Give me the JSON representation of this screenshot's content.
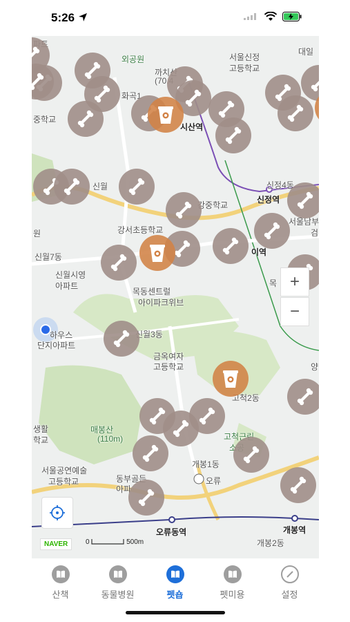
{
  "status_bar": {
    "time": "5:26"
  },
  "map": {
    "labels": {
      "park": "외공원",
      "kkachisan": "까치산",
      "kkachisan_sub": "(70.4",
      "hwagok": "화곡1",
      "sinwon_station": "시산역",
      "seoul_singung": "서울신정",
      "seoul_singung2": "고등학교",
      "daeil": "대일",
      "sinjeong4": "신정4동",
      "sinjeong_station": "신정역",
      "gangjung": "강중학교",
      "gangseo": "강서초등학교",
      "seoulyanggok": "서울남부",
      "geom": "검",
      "sinwol7": "신월7동",
      "sinwol": "신월",
      "sinwolsi": "신월시영",
      "apart": "아파트",
      "mokdong_central": "목동센트럴",
      "ipark": "아이파크위브",
      "sinwol3": "신월3동",
      "house": "하우스",
      "danji": "단지아파트",
      "geumok": "금옥여자",
      "geumok2": "고등학교",
      "gocheok2": "고척2동",
      "maebongsan": "매봉산",
      "maebongsan_h": "(110m)",
      "gocheok_geun": "고척근린",
      "gocheok_geun2": "소공",
      "gaebong1": "개봉1동",
      "seoul_art": "서울공연예술",
      "seoul_art2": "고등학교",
      "dongbu": "동부골든",
      "dongbu2": "아파",
      "oryu_ic": "오류",
      "oryudong_station": "오류동역",
      "gaebong_station": "개봉역",
      "gaebong2": "개봉2동",
      "jungk": "중학교",
      "ipa": "아파",
      "sw": "생활",
      "sw2": "학교",
      "won": "원",
      "ok": "목",
      "yang": "양",
      "sinwon_stop": "신월",
      "ita": "이역",
      "pate": "파트"
    },
    "zoom_in": "+",
    "zoom_out": "−",
    "naver_logo": "NAVER",
    "scale_zero": "0",
    "scale_label": "500m"
  },
  "tabs": [
    {
      "label": "산책",
      "icon": "book-icon"
    },
    {
      "label": "동물병원",
      "icon": "book-icon"
    },
    {
      "label": "펫숍",
      "icon": "book-icon"
    },
    {
      "label": "펫미용",
      "icon": "book-icon"
    },
    {
      "label": "설정",
      "icon": "compass-icon"
    }
  ],
  "colors": {
    "accent": "#1e6fd9",
    "marker": "#a08e88",
    "cafe": "#d28246"
  }
}
